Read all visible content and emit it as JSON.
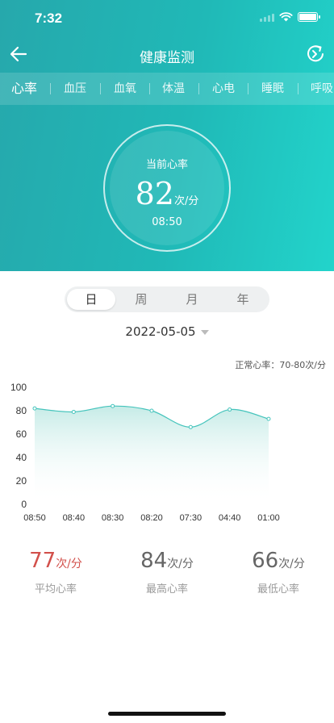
{
  "status": {
    "time": "7:32"
  },
  "nav": {
    "title": "健康监测",
    "back_icon": "arrow-left-icon",
    "refresh_icon": "refresh-icon"
  },
  "tabs": [
    {
      "label": "心率",
      "active": true
    },
    {
      "label": "血压"
    },
    {
      "label": "血氧"
    },
    {
      "label": "体温"
    },
    {
      "label": "心电"
    },
    {
      "label": "睡眠"
    },
    {
      "label": "呼吸"
    }
  ],
  "current": {
    "label": "当前心率",
    "value": "82",
    "unit": "次/分",
    "time": "08:50"
  },
  "period": {
    "items": [
      "日",
      "周",
      "月",
      "年"
    ],
    "selected": "日"
  },
  "date": {
    "value": "2022-05-05"
  },
  "normal_range": "正常心率：70-80次/分",
  "chart_data": {
    "type": "area",
    "x": [
      "08:50",
      "08:40",
      "08:30",
      "08:20",
      "07:30",
      "04:40",
      "01:00"
    ],
    "values": [
      82,
      79,
      84,
      80,
      66,
      81,
      73
    ],
    "ylim": [
      0,
      100
    ],
    "yticks": [
      0,
      20,
      40,
      60,
      80,
      100
    ],
    "grid": false,
    "line_color": "#45c4bc"
  },
  "stats": [
    {
      "value": "77",
      "unit": "次/分",
      "label": "平均心率",
      "color": "#d2504b"
    },
    {
      "value": "84",
      "unit": "次/分",
      "label": "最高心率",
      "color": "#666666"
    },
    {
      "value": "66",
      "unit": "次/分",
      "label": "最低心率",
      "color": "#666666"
    }
  ],
  "colors": {
    "accent": "#20b9b7",
    "chart_line": "#45c4bc",
    "average": "#d2504b"
  }
}
